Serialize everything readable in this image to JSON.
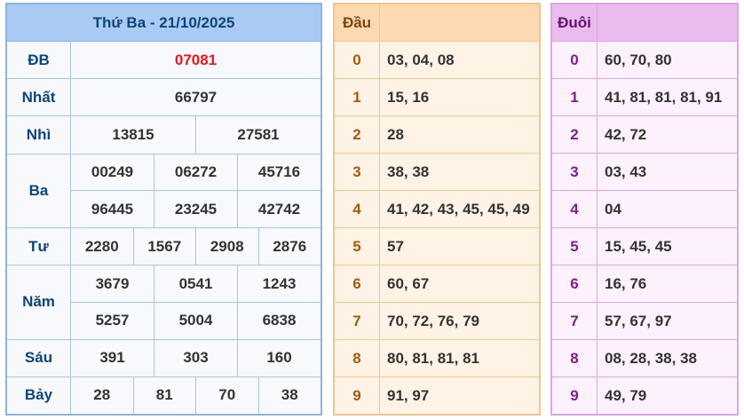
{
  "results": {
    "title": "Thứ Ba - 21/10/2025",
    "prizes": [
      {
        "name": "ĐB",
        "lines": [
          [
            "07081"
          ]
        ]
      },
      {
        "name": "Nhất",
        "lines": [
          [
            "66797"
          ]
        ]
      },
      {
        "name": "Nhì",
        "lines": [
          [
            "13815",
            "27581"
          ]
        ]
      },
      {
        "name": "Ba",
        "lines": [
          [
            "00249",
            "06272",
            "45716"
          ],
          [
            "96445",
            "23245",
            "42742"
          ]
        ]
      },
      {
        "name": "Tư",
        "lines": [
          [
            "2280",
            "1567",
            "2908",
            "2876"
          ]
        ]
      },
      {
        "name": "Năm",
        "lines": [
          [
            "3679",
            "0541",
            "1243"
          ],
          [
            "5257",
            "5004",
            "6838"
          ]
        ]
      },
      {
        "name": "Sáu",
        "lines": [
          [
            "391",
            "303",
            "160"
          ]
        ]
      },
      {
        "name": "Bảy",
        "lines": [
          [
            "28",
            "81",
            "70",
            "38"
          ]
        ]
      }
    ]
  },
  "dau": {
    "header": "Đầu",
    "rows": [
      {
        "digit": "0",
        "values": "03, 04, 08"
      },
      {
        "digit": "1",
        "values": "15, 16"
      },
      {
        "digit": "2",
        "values": "28"
      },
      {
        "digit": "3",
        "values": "38, 38"
      },
      {
        "digit": "4",
        "values": "41, 42, 43, 45, 45, 49"
      },
      {
        "digit": "5",
        "values": "57"
      },
      {
        "digit": "6",
        "values": "60, 67"
      },
      {
        "digit": "7",
        "values": "70, 72, 76, 79"
      },
      {
        "digit": "8",
        "values": "80, 81, 81, 81"
      },
      {
        "digit": "9",
        "values": "91, 97"
      }
    ]
  },
  "duoi": {
    "header": "Đuôi",
    "rows": [
      {
        "digit": "0",
        "values": "60, 70, 80"
      },
      {
        "digit": "1",
        "values": "41, 81, 81, 81, 91"
      },
      {
        "digit": "2",
        "values": "42, 72"
      },
      {
        "digit": "3",
        "values": "03, 43"
      },
      {
        "digit": "4",
        "values": "04"
      },
      {
        "digit": "5",
        "values": "15, 45, 45"
      },
      {
        "digit": "6",
        "values": "16, 76"
      },
      {
        "digit": "7",
        "values": "57, 67, 97"
      },
      {
        "digit": "8",
        "values": "08, 28, 38, 38"
      },
      {
        "digit": "9",
        "values": "49, 79"
      }
    ]
  },
  "colors": {
    "special_prize": "#e8151b",
    "results_header": "#a9cbf3",
    "dau_header": "#fcd9b0",
    "duoi_header": "#ebbbf0"
  }
}
